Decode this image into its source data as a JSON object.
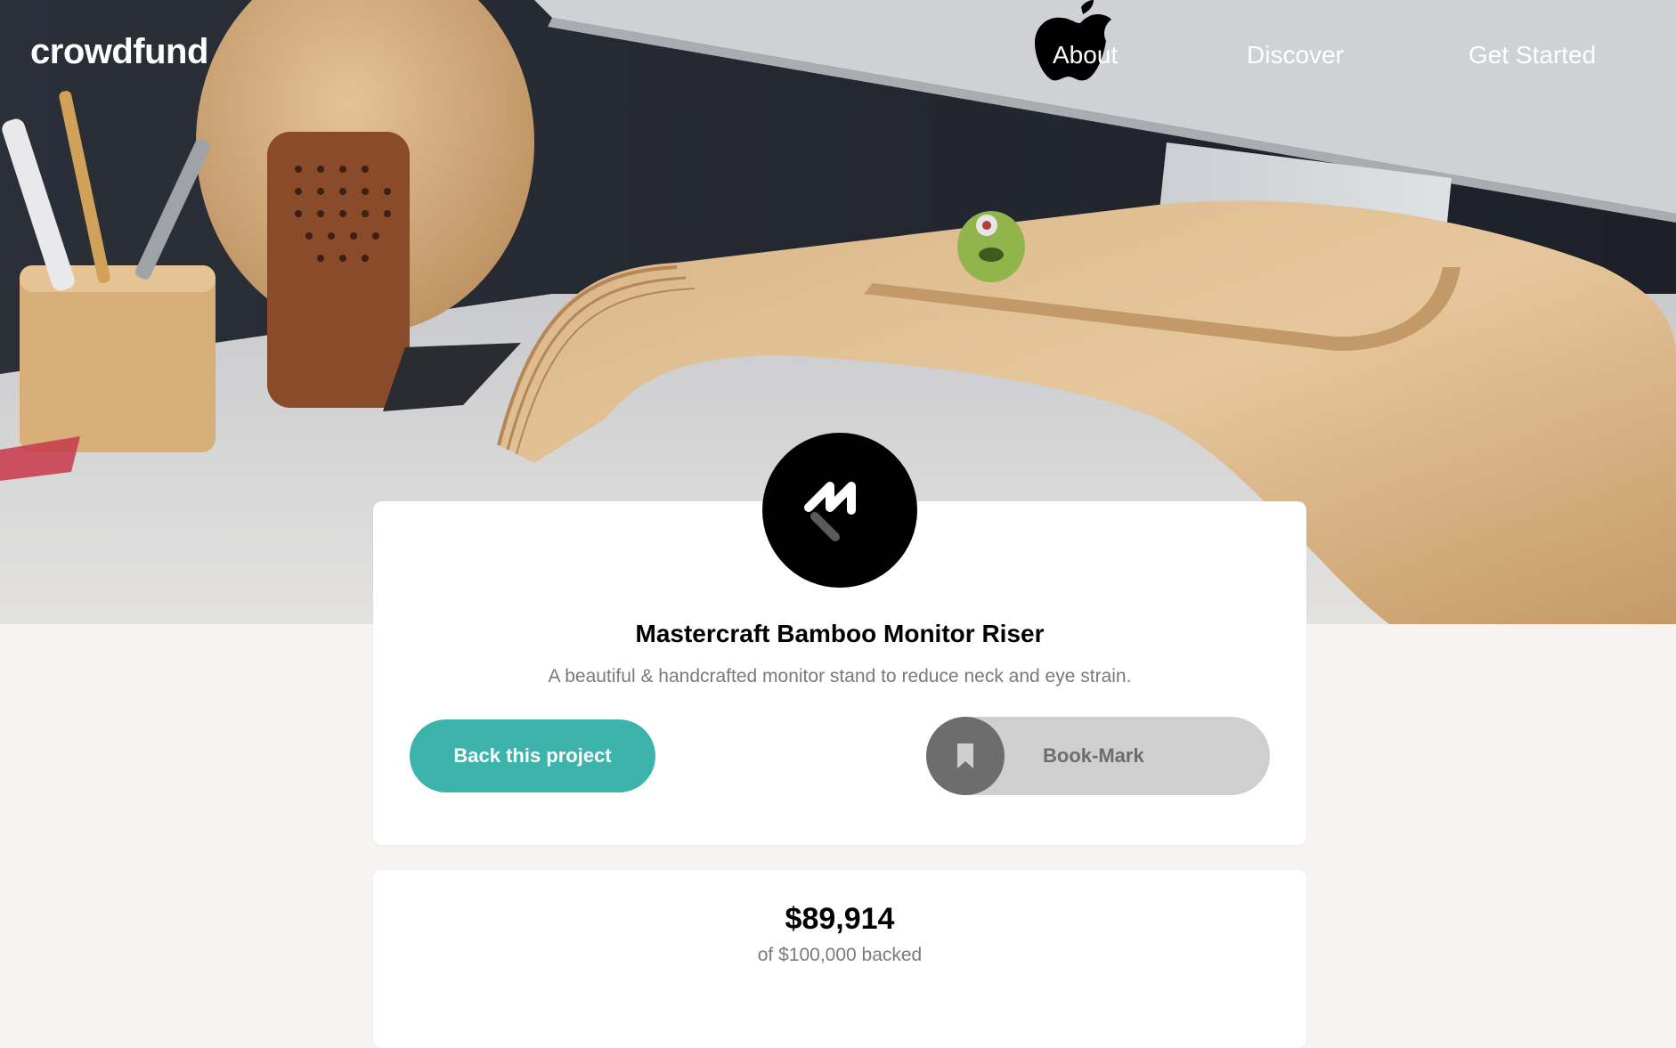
{
  "header": {
    "logo": "crowdfund",
    "nav": {
      "about": "About",
      "discover": "Discover",
      "get_started": "Get Started"
    }
  },
  "hero": {
    "image": "desk-with-bamboo-monitor-riser"
  },
  "project": {
    "title": "Mastercraft Bamboo Monitor Riser",
    "description": "A beautiful & handcrafted monitor stand to reduce neck and eye strain.",
    "back_label": "Back this project",
    "bookmark_label": "Book-Mark",
    "logo_icon": "mastercraft-logo-icon",
    "bookmark_icon": "bookmark-icon"
  },
  "stats": {
    "amount": "$89,914",
    "subtitle": "of $100,000 backed"
  },
  "colors": {
    "accent": "#3cb3ab",
    "bookmark_bg": "#cfcfcf",
    "bookmark_circle": "#6d6d6d",
    "page_bg": "#f5f4f2"
  }
}
